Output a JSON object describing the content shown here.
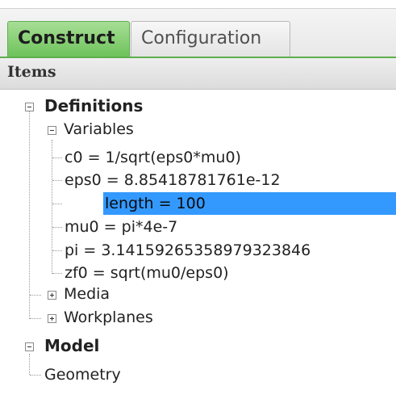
{
  "tabs": [
    {
      "label": "Construct",
      "active": true
    },
    {
      "label": "Configuration",
      "active": false
    }
  ],
  "panel": {
    "title": "Items"
  },
  "tree": {
    "definitions": {
      "label": "Definitions",
      "variables": {
        "label": "Variables",
        "items": [
          "c0 = 1/sqrt(eps0*mu0)",
          "eps0 = 8.85418781761e-12",
          "length = 100",
          "mu0 = pi*4e-7",
          "pi = 3.14159265358979323846",
          "zf0 = sqrt(mu0/eps0)"
        ],
        "selected": "length = 100"
      },
      "media": {
        "label": "Media"
      },
      "workplanes": {
        "label": "Workplanes"
      }
    },
    "model": {
      "label": "Model",
      "geometry": {
        "label": "Geometry"
      }
    }
  },
  "colors": {
    "accent_tab": "#6cc25a",
    "selection": "#3399ff"
  }
}
